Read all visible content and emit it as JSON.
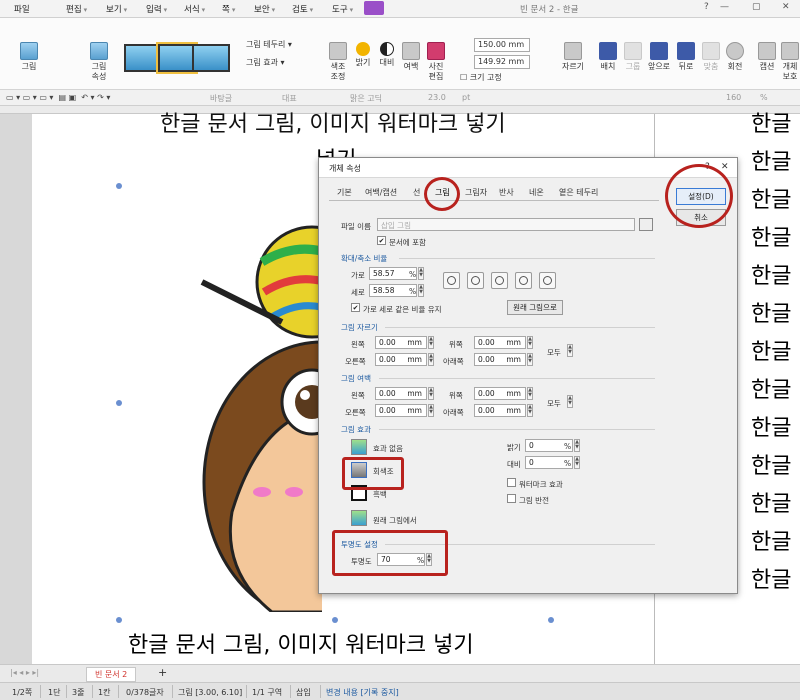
{
  "menu": {
    "file": "파일",
    "edit": "편집",
    "view": "보기",
    "input": "입력",
    "format": "서식",
    "page": "쪽",
    "security": "보안",
    "review": "검토",
    "tools": "도구",
    "title": "빈 문서 2 - 한글",
    "help": "?"
  },
  "ribbon": {
    "picture": "그림",
    "picture_props_1": "그림",
    "picture_props_2": "속성",
    "border": "그림 테두리",
    "effect": "그림 효과",
    "color_adjust_1": "색조",
    "color_adjust_2": "조정",
    "brightness": "밝기",
    "contrast": "대비",
    "margin": "여백",
    "photo_edit_1": "사진",
    "photo_edit_2": "편집",
    "width_value": "150.00",
    "height_value": "149.92",
    "unit": "mm",
    "size_lock": "크기 고정",
    "crop": "자르기",
    "arrange": "배치",
    "group": "그룹",
    "bring_front": "앞으로",
    "send_back": "뒤로",
    "align": "맞춤",
    "rotate": "회전",
    "caption": "캡션",
    "obj_protect_1": "개체",
    "obj_protect_2": "보호"
  },
  "toolbar2": {
    "style": "바탕글",
    "para": "대표",
    "font": "맑은 고딕",
    "size": "23.0",
    "unit": "pt",
    "zoom": "160",
    "pct": "%"
  },
  "document": {
    "top_line": "한글 문서 그림, 이미지 워터마크 넣기",
    "insert_line": "넣기",
    "bottom_line": "한글 문서 그림, 이미지 워터마크 넣기",
    "right_col": [
      "한글",
      "한글",
      "한글",
      "한글",
      "한글",
      "한글",
      "한글",
      "한글",
      "한글",
      "한글",
      "한글",
      "한글",
      "한글",
      "한글"
    ]
  },
  "dialog": {
    "title": "개체 속성",
    "tabs": [
      "기본",
      "여백/캡션",
      "선",
      "그림",
      "그림자",
      "반사",
      "네온",
      "옅은 테두리"
    ],
    "ok": "설정(D)",
    "cancel": "취소",
    "file_name_label": "파일 이름",
    "file_name_value": "삽입 그림",
    "embed_label": "문서에 포함",
    "scale_section": "확대/축소 비율",
    "width_label": "가로",
    "width_value": "58.57",
    "height_label": "세로",
    "height_value": "58.58",
    "percent": "%",
    "keep_ratio_label": "가로 세로 같은 비율 유지",
    "original_btn": "원래 그림으로",
    "crop_section": "그림 자르기",
    "margin_section": "그림 여백",
    "left": "왼쪽",
    "top": "위쪽",
    "right": "오른쪽",
    "bottom": "아래쪽",
    "all": "모두",
    "zero_mm": "0.00",
    "mm": "mm",
    "effect_section": "그림 효과",
    "no_effect": "효과 없음",
    "grayscale": "회색조",
    "black_white": "흑백",
    "from_original": "원래 그림에서",
    "brightness_label": "밝기",
    "brightness_value": "0",
    "contrast_label": "대비",
    "contrast_value": "0",
    "watermark_label": "워터마크 효과",
    "invert_label": "그림 반전",
    "transparency_section": "투명도 설정",
    "transparency_label": "투명도",
    "transparency_value": "70"
  },
  "tabbar": {
    "doc_tab": "빈 문서 2",
    "add": "+"
  },
  "status": {
    "page": "1/2쪽",
    "col": "1단",
    "line": "3줄",
    "kan": "1칸",
    "chars": "0/378글자",
    "object": "그림 [3.00, 6.10]",
    "section": "1/1 구역",
    "insert": "삽입",
    "track": "변경 내용 [기록 중지]"
  },
  "colors": {
    "accent_red": "#b8221e",
    "accent_blue": "#1d5aa0",
    "tools_purple": "#9a4fc8"
  }
}
